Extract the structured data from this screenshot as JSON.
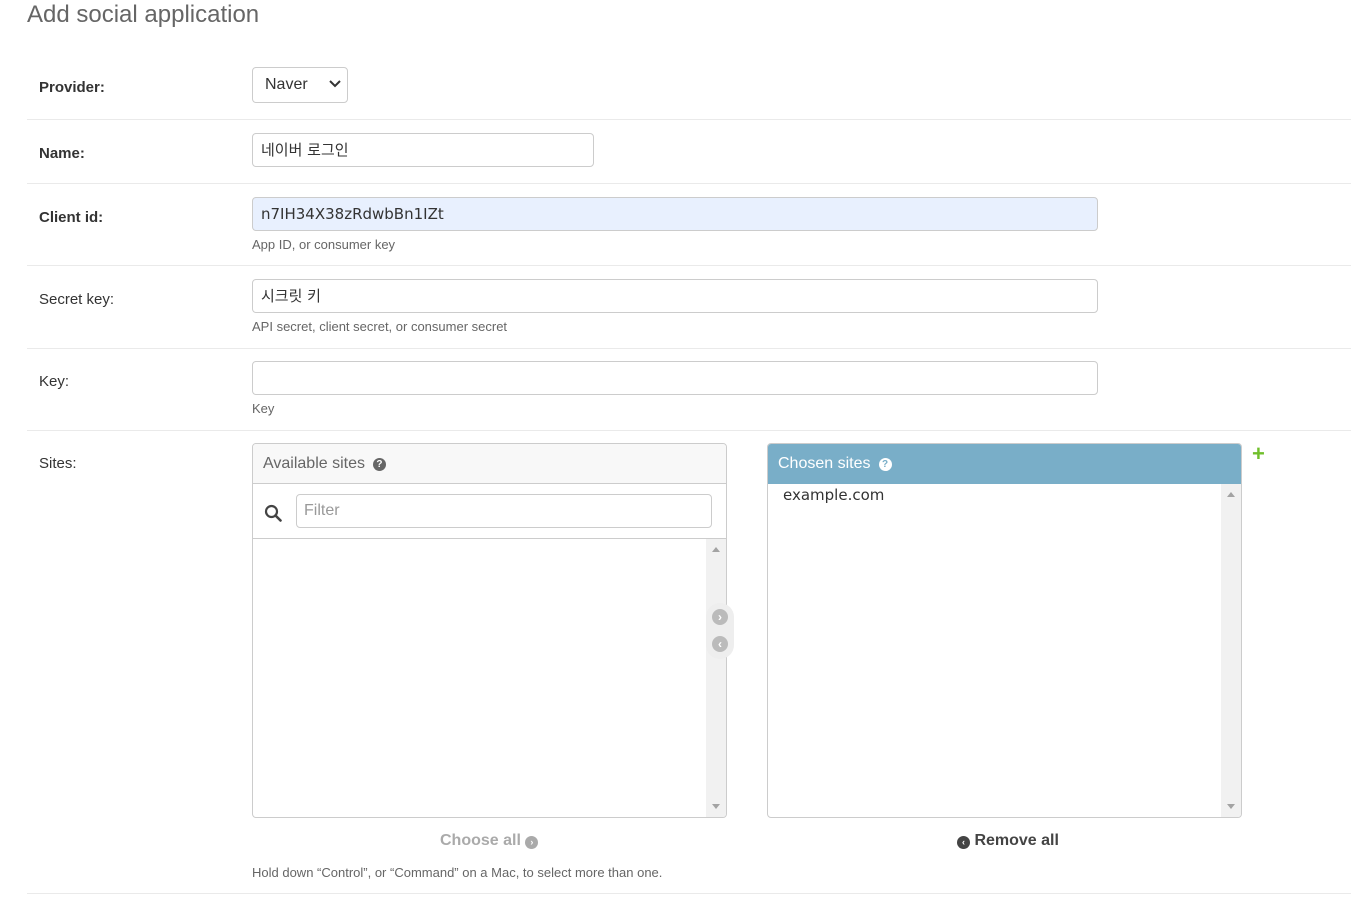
{
  "page": {
    "title": "Add social application"
  },
  "form": {
    "provider": {
      "label": "Provider:",
      "value": "Naver"
    },
    "name": {
      "label": "Name:",
      "value": "네이버 로그인"
    },
    "client_id": {
      "label": "Client id:",
      "value": "n7IH34X38zRdwbBn1IZt",
      "help": "App ID, or consumer key"
    },
    "secret_key": {
      "label": "Secret key:",
      "value": "시크릿 키",
      "help": "API secret, client secret, or consumer secret"
    },
    "key": {
      "label": "Key:",
      "value": "",
      "help": "Key"
    },
    "sites": {
      "label": "Sites:",
      "available_title": "Available sites",
      "filter_placeholder": "Filter",
      "available_options": [],
      "chosen_title": "Chosen sites",
      "chosen_options": [
        "example.com"
      ],
      "choose_all_label": "Choose all",
      "remove_all_label": "Remove all",
      "help": "Hold down “Control”, or “Command” on a Mac, to select more than one."
    }
  },
  "icons": {
    "select_chevron": "chevron-down-icon",
    "help": "question-circle-icon",
    "search": "search-icon",
    "add_right": "arrow-right-circle-icon",
    "remove_left": "arrow-left-circle-icon",
    "add_related": "plus-icon"
  },
  "colors": {
    "chosen_header": "#79aec8",
    "plus": "#70bf2b",
    "client_id_bg": "#e8f0fe"
  }
}
